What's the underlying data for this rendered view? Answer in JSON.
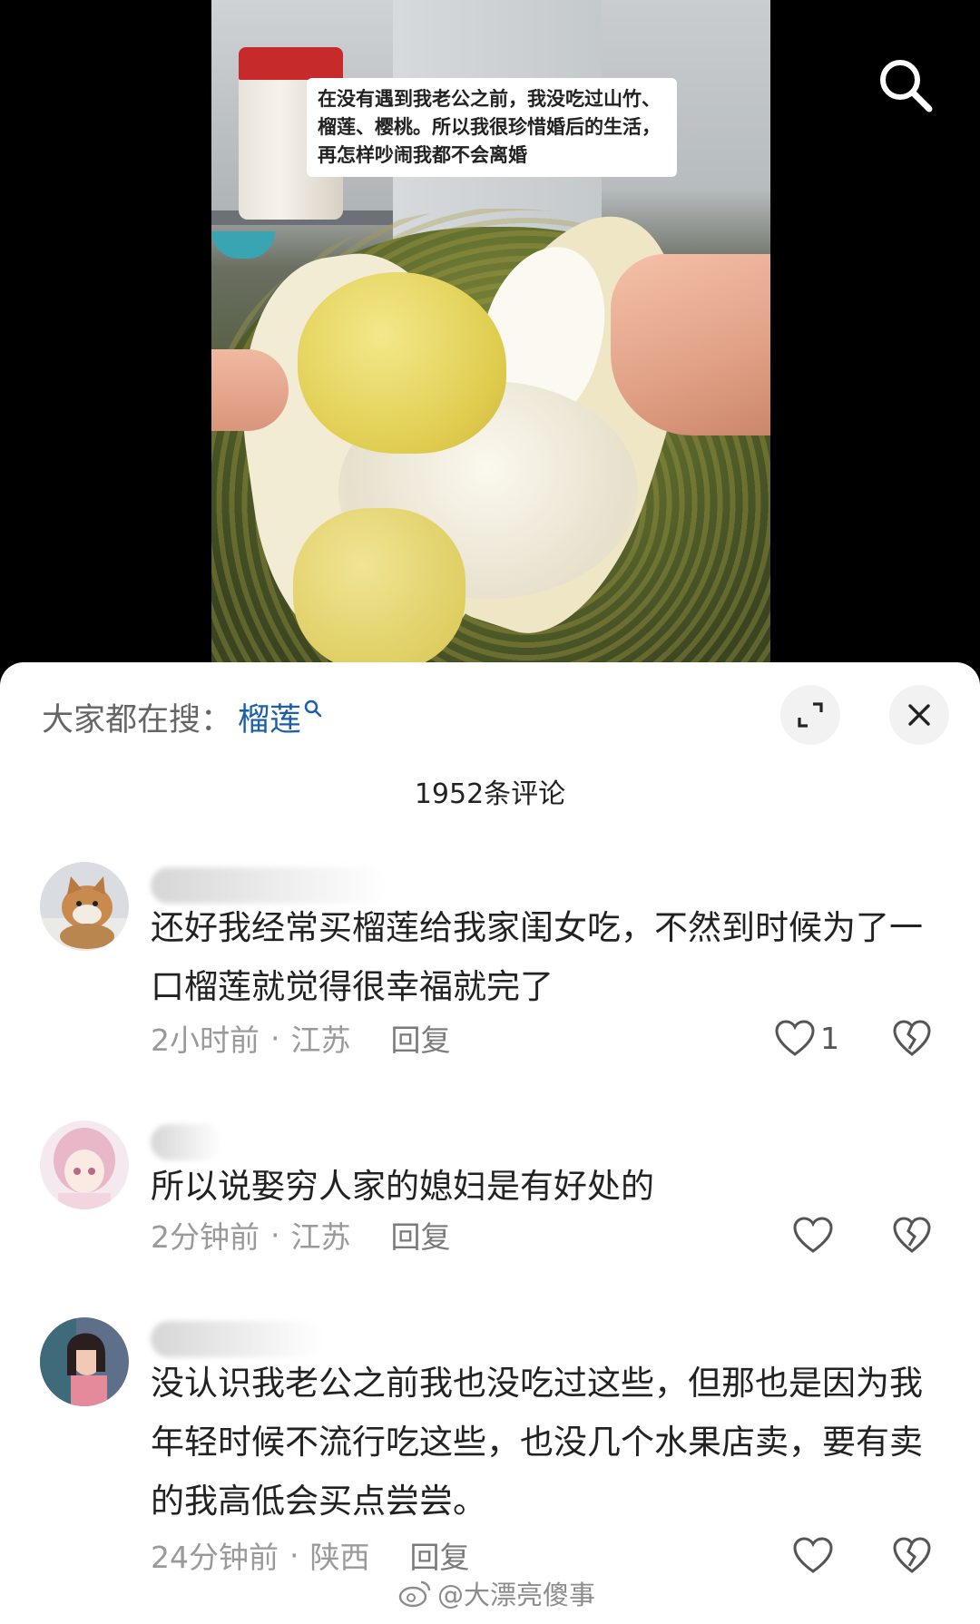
{
  "video": {
    "caption": "在没有遇到我老公之前，我没吃过山竹、榴莲、樱桃。所以我很珍惜婚后的生活，再怎样吵闹我都不会离婚",
    "search_icon": "search-icon"
  },
  "comments_panel": {
    "trending_label": "大家都在搜：",
    "trending_term": "榴莲",
    "expand_icon": "expand-icon",
    "close_icon": "close-icon",
    "count_text": "1952条评论",
    "comments": [
      {
        "text": "还好我经常买榴莲给我家闺女吃，不然到时候为了一口榴莲就觉得很幸福就完了",
        "time": "2小时前",
        "location": "江苏",
        "reply_label": "回复",
        "likes": "1"
      },
      {
        "text": "所以说娶穷人家的媳妇是有好处的",
        "time": "2分钟前",
        "location": "江苏",
        "reply_label": "回复",
        "likes": ""
      },
      {
        "text": "没认识我老公之前我也没吃过这些，但那也是因为我年轻时候不流行吃这些，也没几个水果店卖，要有卖的我高低会买点尝尝。",
        "time": "24分钟前",
        "location": "陕西",
        "reply_label": "回复",
        "likes": ""
      }
    ],
    "meta_separator": "·"
  },
  "watermark": "@大漂亮傻事",
  "colors": {
    "link_blue": "#1a5fa8",
    "meta_gray": "#9a9a9a",
    "caption_bg": "#ffffff"
  }
}
